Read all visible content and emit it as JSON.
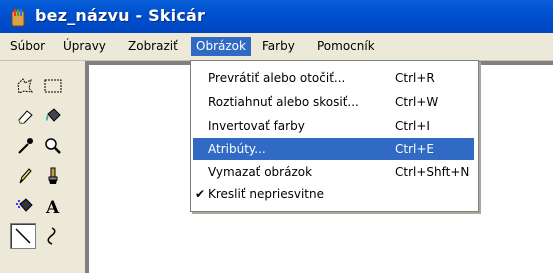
{
  "window": {
    "title": "bez_názvu - Skicár"
  },
  "menubar": {
    "items": [
      {
        "label": "Súbor"
      },
      {
        "label": "Úpravy"
      },
      {
        "label": "Zobraziť"
      },
      {
        "label": "Obrázok"
      },
      {
        "label": "Farby"
      },
      {
        "label": "Pomocník"
      }
    ],
    "active": "Obrázok"
  },
  "toolbox": {
    "tools": [
      "free-form-select-icon",
      "rect-select-icon",
      "eraser-icon",
      "fill-bucket-icon",
      "color-picker-icon",
      "magnifier-icon",
      "pencil-icon",
      "brush-icon",
      "airbrush-icon",
      "text-icon",
      "line-icon",
      "curve-icon"
    ],
    "selected": "line-icon"
  },
  "dropdown": {
    "items": [
      {
        "label": "Prevrátiť alebo otočiť...",
        "shortcut": "Ctrl+R"
      },
      {
        "label": "Roztiahnuť alebo skosiť...",
        "shortcut": "Ctrl+W"
      },
      {
        "label": "Invertovať farby",
        "shortcut": "Ctrl+I"
      },
      {
        "label": "Atribúty...",
        "shortcut": "Ctrl+E",
        "highlighted": true
      },
      {
        "label": "Vymazať obrázok",
        "shortcut": "Ctrl+Shft+N"
      },
      {
        "label": "Kresliť nepriesvitne",
        "shortcut": "",
        "checked": true
      }
    ]
  },
  "colors": {
    "title_bar": "#0050d0",
    "highlight": "#316ac5",
    "menu_bg": "#ece9d8",
    "workspace": "#808080"
  }
}
